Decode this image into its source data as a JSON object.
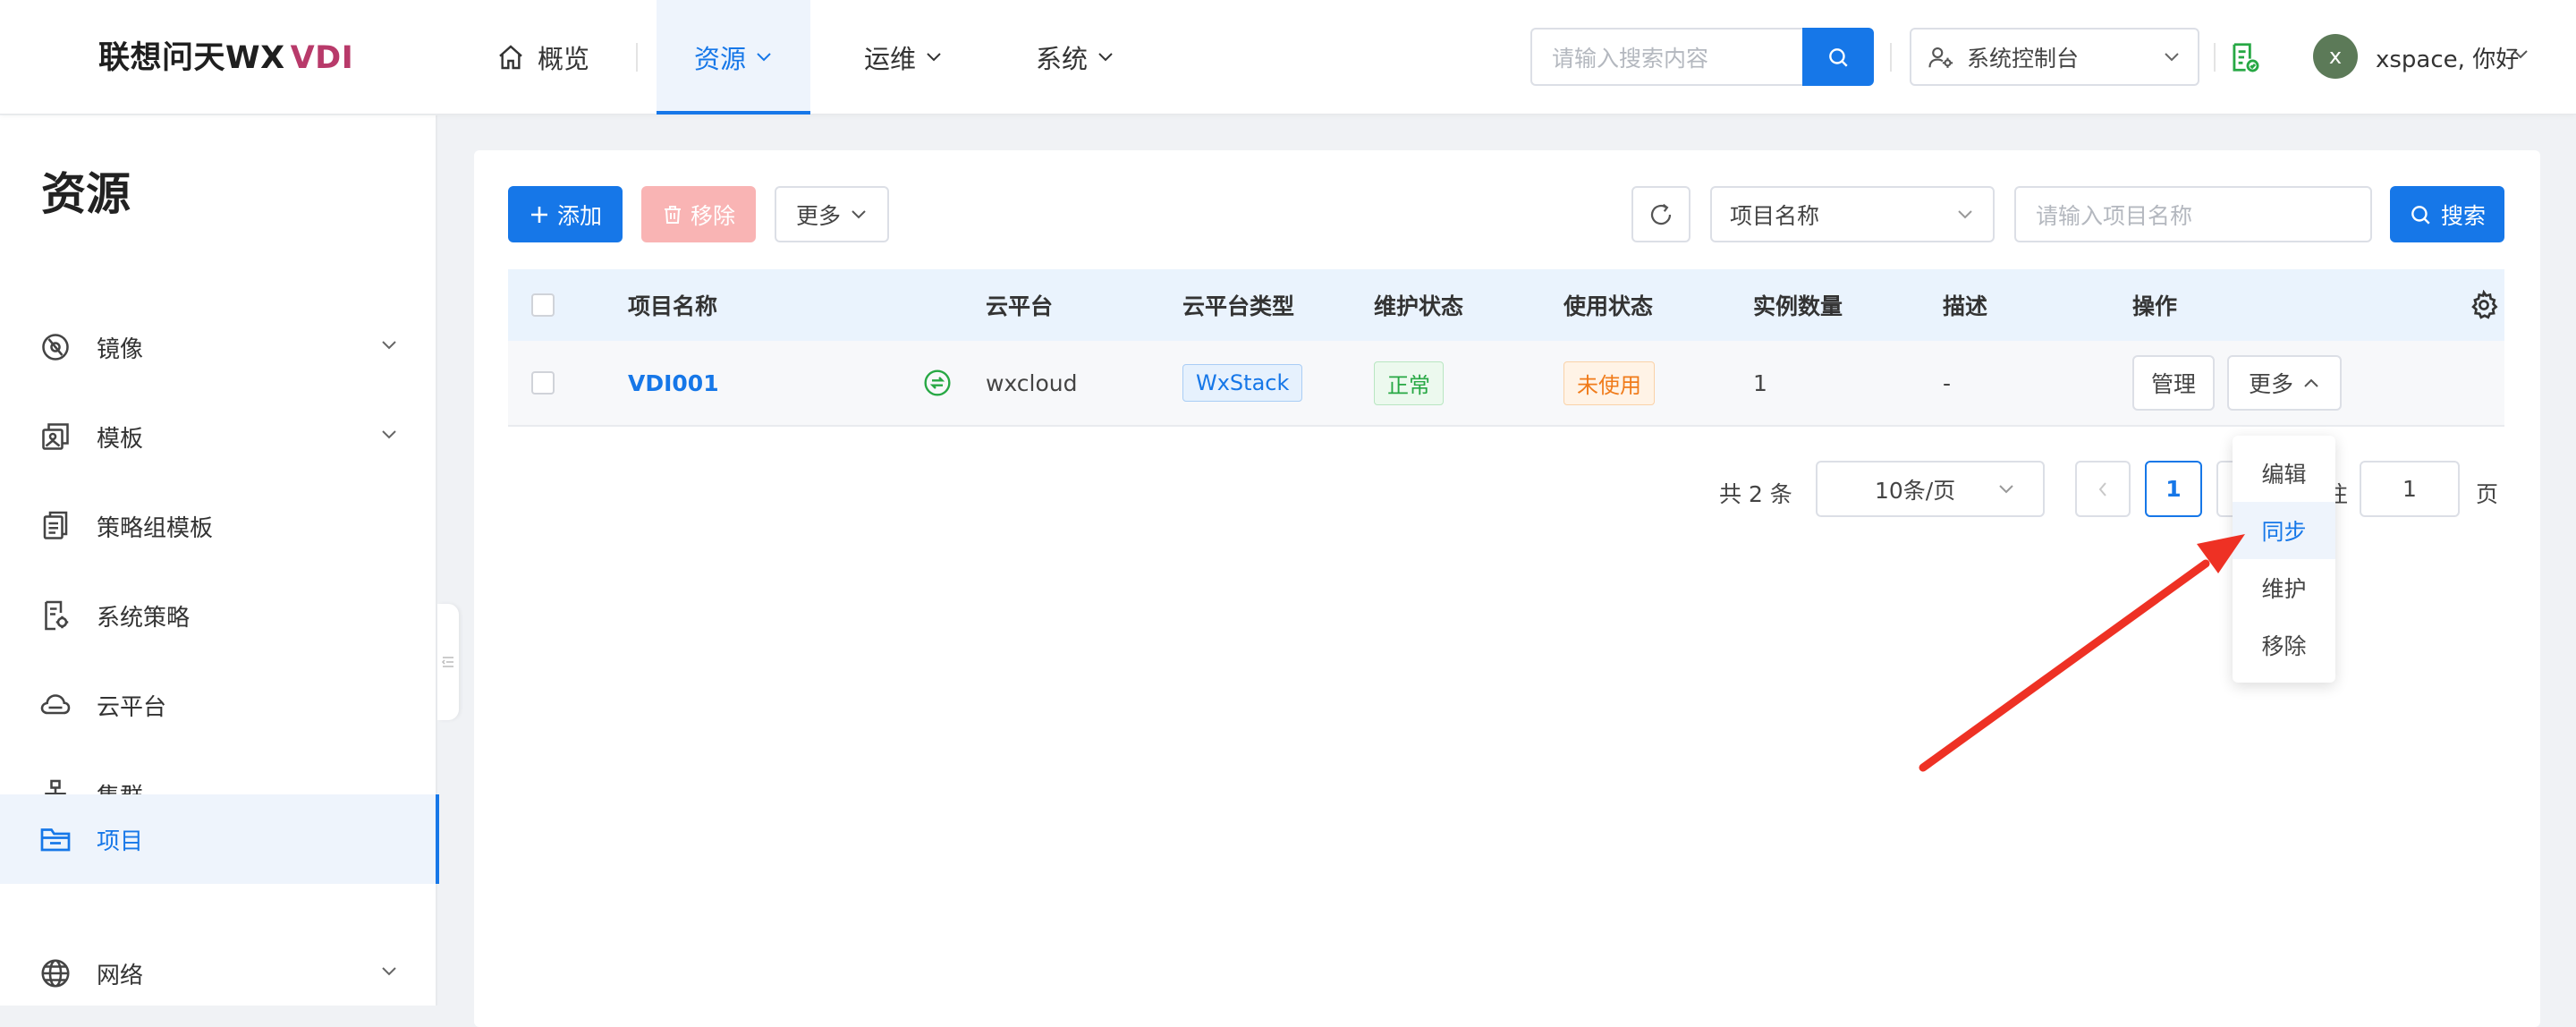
{
  "header": {
    "logo_main": "联想问天WX",
    "logo_accent": "VDI",
    "nav": [
      {
        "label": "概览"
      },
      {
        "label": "资源"
      },
      {
        "label": "运维"
      },
      {
        "label": "系统"
      }
    ],
    "search_placeholder": "请输入搜索内容",
    "console_label": "系统控制台",
    "avatar_initial": "x",
    "user_greeting": "xspace, 你好"
  },
  "sidebar": {
    "title": "资源",
    "items": [
      {
        "label": "镜像",
        "icon": "image-icon",
        "has_submenu": true
      },
      {
        "label": "模板",
        "icon": "template-icon",
        "has_submenu": true
      },
      {
        "label": "策略组模板",
        "icon": "policy-group-icon",
        "has_submenu": false
      },
      {
        "label": "系统策略",
        "icon": "system-policy-icon",
        "has_submenu": false
      },
      {
        "label": "云平台",
        "icon": "cloud-icon",
        "has_submenu": false
      },
      {
        "label": "集群",
        "icon": "cluster-icon",
        "has_submenu": false
      },
      {
        "label": "项目",
        "icon": "folder-icon",
        "has_submenu": false,
        "active": true
      },
      {
        "label": "网络",
        "icon": "globe-icon",
        "has_submenu": true
      }
    ]
  },
  "toolbar": {
    "add_label": "添加",
    "remove_label": "移除",
    "more_label": "更多",
    "field_select": "项目名称",
    "search_placeholder": "请输入项目名称",
    "search_label": "搜索"
  },
  "table": {
    "columns": [
      "项目名称",
      "云平台",
      "云平台类型",
      "维护状态",
      "使用状态",
      "实例数量",
      "描述",
      "操作"
    ],
    "rows": [
      {
        "name": "VDI001",
        "platform": "wxcloud",
        "platform_type": "WxStack",
        "maintenance": "正常",
        "usage": "未使用",
        "instances": "1",
        "description": "-",
        "manage_label": "管理",
        "more_label": "更多"
      }
    ]
  },
  "pagination": {
    "total": "共 2 条",
    "page_size": "10条/页",
    "current_page": "1",
    "goto_prefix": "往",
    "goto_value": "1",
    "goto_suffix": "页"
  },
  "dropdown": {
    "items": [
      "编辑",
      "同步",
      "维护",
      "移除"
    ],
    "highlighted": "同步"
  },
  "colors": {
    "accent": "#1677e8",
    "danger_light": "#f9b4b4",
    "success": "#27a844",
    "warning": "#f07b1a",
    "annotation_arrow": "#ee3124"
  }
}
